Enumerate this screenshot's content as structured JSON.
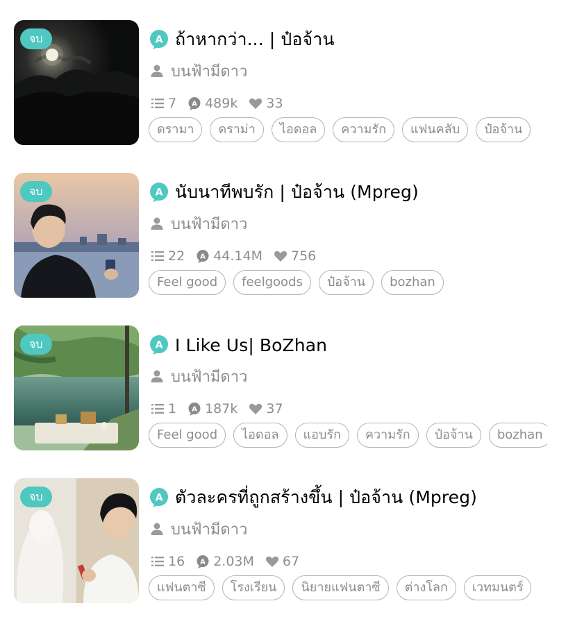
{
  "stories": [
    {
      "status": "จบ",
      "title": "ถ้าหากว่า... | ป๋อจ้าน",
      "author": "บนฟ้ามีดาว",
      "chapters": "7",
      "views": "489k",
      "likes": "33",
      "tags": [
        "ดรามา",
        "ดราม่า",
        "ไอดอล",
        "ความรัก",
        "แฟนคลับ",
        "ป๋อจ้าน"
      ]
    },
    {
      "status": "จบ",
      "title": "นับนาทีพบรัก | ป๋อจ้าน (Mpreg)",
      "author": "บนฟ้ามีดาว",
      "chapters": "22",
      "views": "44.14M",
      "likes": "756",
      "tags": [
        "Feel good",
        "feelgoods",
        "ป๋อจ้าน",
        "bozhan"
      ]
    },
    {
      "status": "จบ",
      "title": "I Like Us| BoZhan",
      "author": "บนฟ้ามีดาว",
      "chapters": "1",
      "views": "187k",
      "likes": "37",
      "tags": [
        "Feel good",
        "ไอดอล",
        "แอบรัก",
        "ความรัก",
        "ป๋อจ้าน",
        "bozhan"
      ]
    },
    {
      "status": "จบ",
      "title": "ตัวละครที่ถูกสร้างขึ้น | ป๋อจ้าน (Mpreg)",
      "author": "บนฟ้ามีดาว",
      "chapters": "16",
      "views": "2.03M",
      "likes": "67",
      "tags": [
        "แฟนตาซี",
        "โรงเรียน",
        "นิยายแฟนตาซี",
        "ต่างโลก",
        "เวทมนตร์"
      ]
    }
  ],
  "colors": {
    "accent": "#4ec8c0",
    "muted": "#8d8d8d",
    "tag_border": "#b3b3b3"
  },
  "icons": {
    "type_badge": "a-letter-bubble-icon",
    "author": "person-icon",
    "chapters": "list-icon",
    "views": "eye-badge-icon",
    "likes": "heart-icon"
  }
}
